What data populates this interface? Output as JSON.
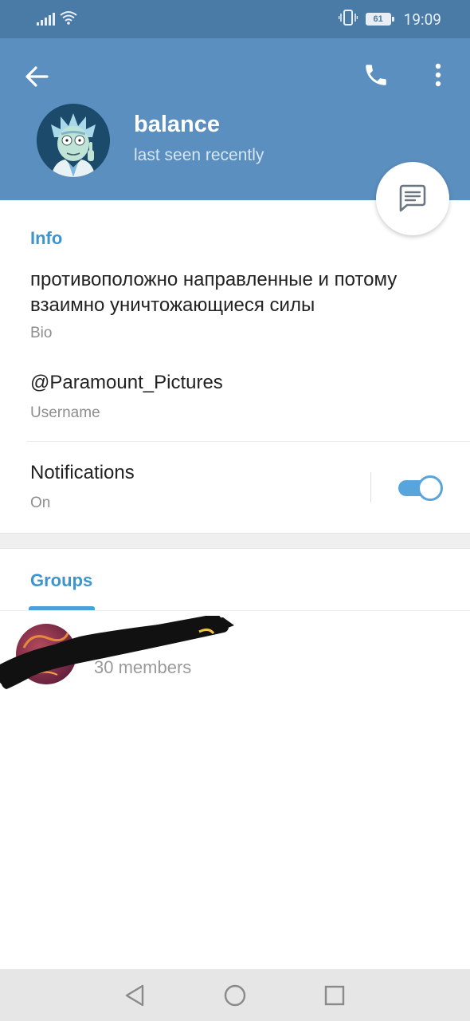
{
  "status_bar": {
    "time": "19:09",
    "battery": "61",
    "icons": [
      "signal-icon",
      "wifi-icon",
      "vibrate-icon",
      "battery-icon"
    ]
  },
  "header": {
    "name": "balance",
    "status": "last seen recently",
    "background_color": "#5b8fc0",
    "icons": [
      "back-arrow-icon",
      "phone-icon",
      "more-vert-icon"
    ]
  },
  "fab": {
    "icon": "message-icon"
  },
  "info": {
    "title": "Info",
    "bio_value": "противоположно направленные и потому взаимно уничтожающиеся силы",
    "bio_label": "Bio",
    "username_value": "@Paramount_Pictures",
    "username_label": "Username",
    "notifications_label": "Notifications",
    "notifications_value": "On",
    "notifications_enabled": true
  },
  "groups": {
    "tab_label": "Groups",
    "items": [
      {
        "members": "30 members"
      }
    ]
  },
  "nav_bar": {
    "icons": [
      "nav-back-icon",
      "nav-home-icon",
      "nav-recents-icon"
    ]
  },
  "colors": {
    "accent": "#3d95ce",
    "status_bar": "#4a7aa6",
    "toggle_on": "#58a5dd"
  }
}
